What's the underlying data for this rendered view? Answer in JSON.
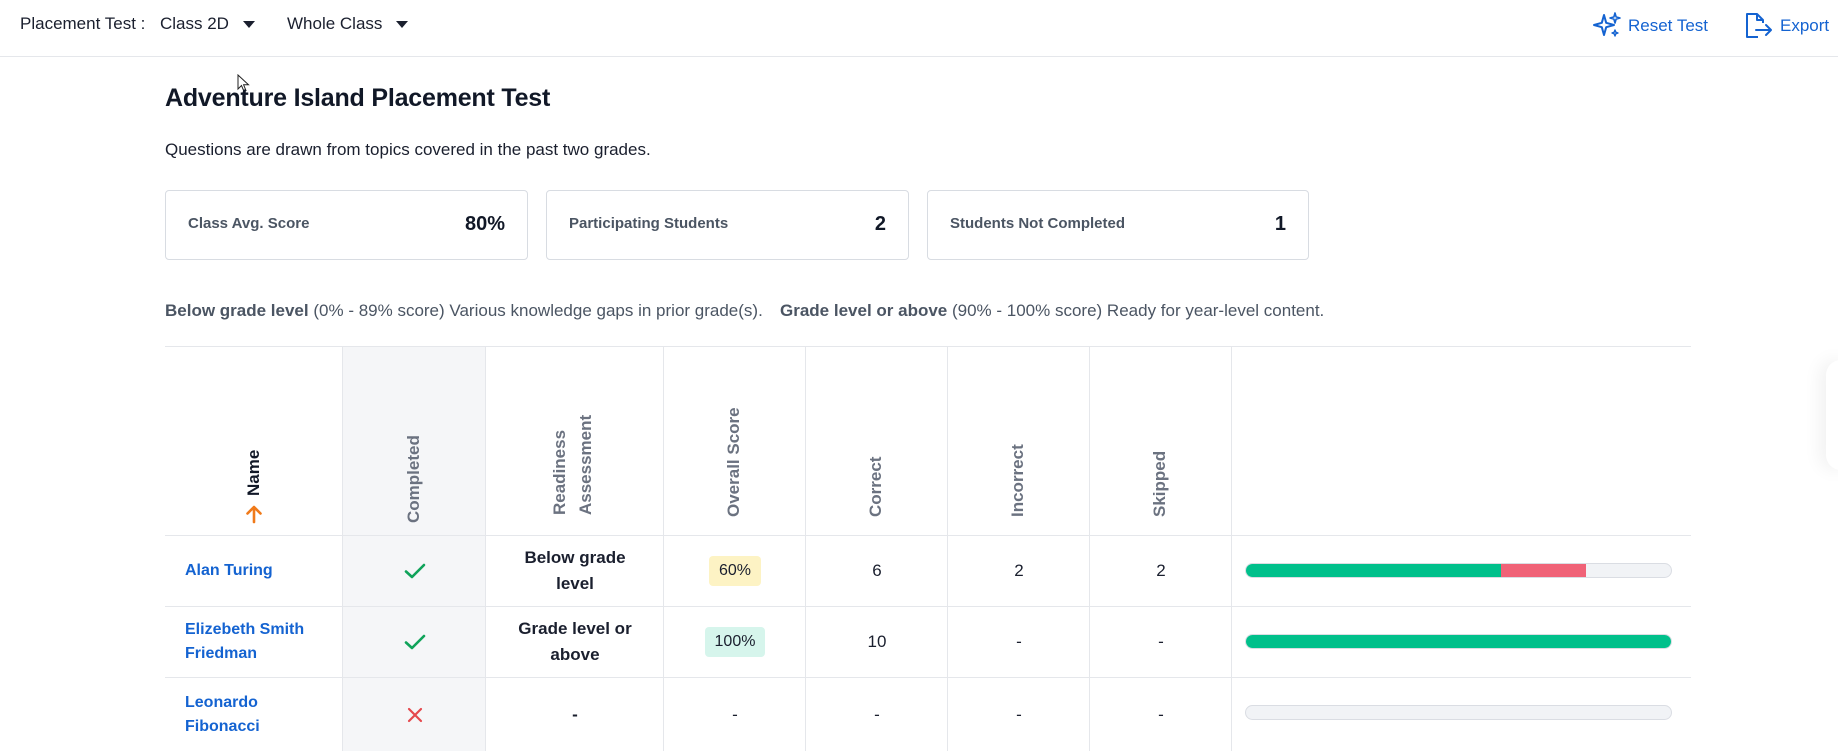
{
  "topbar": {
    "label": "Placement Test :",
    "class_select": "Class 2D",
    "group_select": "Whole Class",
    "reset_label": "Reset Test",
    "export_label": "Export",
    "accent": "#1463d1"
  },
  "page": {
    "title": "Adventure Island Placement Test",
    "subtitle": "Questions are drawn from topics covered in the past two grades."
  },
  "cards": [
    {
      "label": "Class Avg. Score",
      "value": "80%"
    },
    {
      "label": "Participating Students",
      "value": "2"
    },
    {
      "label": "Students Not Completed",
      "value": "1"
    }
  ],
  "legend": {
    "below_title": "Below grade level",
    "below_text": "(0% - 89% score) Various knowledge gaps in prior grade(s).",
    "above_title": "Grade level or above",
    "above_text": "(90% - 100% score) Ready for year-level content."
  },
  "table": {
    "headers": {
      "name": "Name",
      "completed": "Completed",
      "readiness_1": "Readiness",
      "readiness_2": "Assessment",
      "overall": "Overall Score",
      "correct": "Correct",
      "incorrect": "Incorrect",
      "skipped": "Skipped"
    },
    "rows": [
      {
        "name_1": "Alan Turing",
        "name_2": "",
        "completed": true,
        "readiness_1": "Below grade",
        "readiness_2": "level",
        "score": "60%",
        "correct": "6",
        "incorrect": "2",
        "skipped": "2",
        "correct_fraction": 0.6,
        "incorrect_fraction": 0.2
      },
      {
        "name_1": "Elizebeth Smith",
        "name_2": "Friedman",
        "completed": true,
        "readiness_1": "Grade level or",
        "readiness_2": "above",
        "score": "100%",
        "correct": "10",
        "incorrect": "-",
        "skipped": "-",
        "correct_fraction": 1.0,
        "incorrect_fraction": 0
      },
      {
        "name_1": "Leonardo",
        "name_2": "Fibonacci",
        "completed": false,
        "readiness_1": "-",
        "readiness_2": "",
        "score": "-",
        "correct": "-",
        "incorrect": "-",
        "skipped": "-",
        "correct_fraction": 0,
        "incorrect_fraction": 0
      }
    ]
  },
  "colors": {
    "correct": "#00c08b",
    "incorrect": "#f06277",
    "check": "#10a35a",
    "cross": "#e5484d",
    "sort_arrow": "#f07a1a"
  }
}
